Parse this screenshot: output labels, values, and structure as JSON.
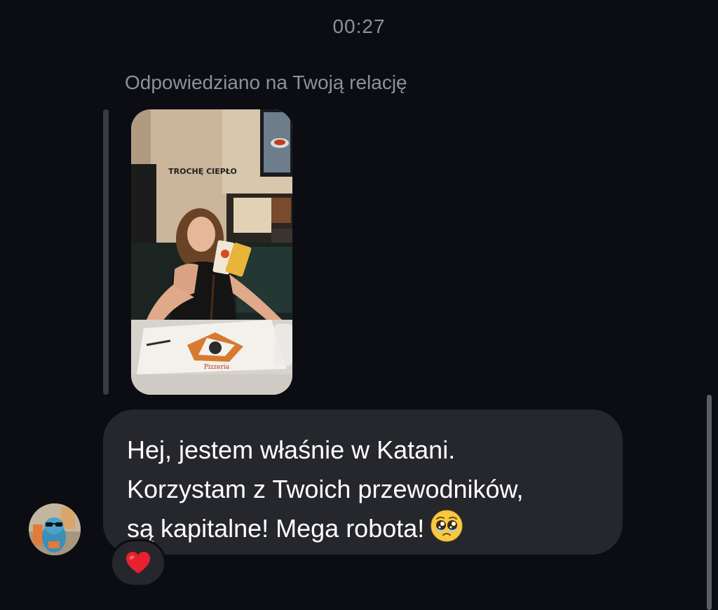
{
  "timestamp": "00:27",
  "reply_context": "Odpowiedziano na Twoją relację",
  "story": {
    "sign_text": "TROCHĘ CIEPŁO"
  },
  "message": {
    "lines": [
      "Hej, jestem właśnie w Katani.",
      "Korzystam z Twoich przewodników,",
      "są kapitalne! Mega robota!"
    ],
    "emoji": "pleading-face"
  },
  "reaction": {
    "emoji": "red-heart"
  },
  "colors": {
    "background": "#0c0d12",
    "bubble": "#26272c",
    "muted_text": "#8e9199",
    "heart": "#e8202f"
  }
}
